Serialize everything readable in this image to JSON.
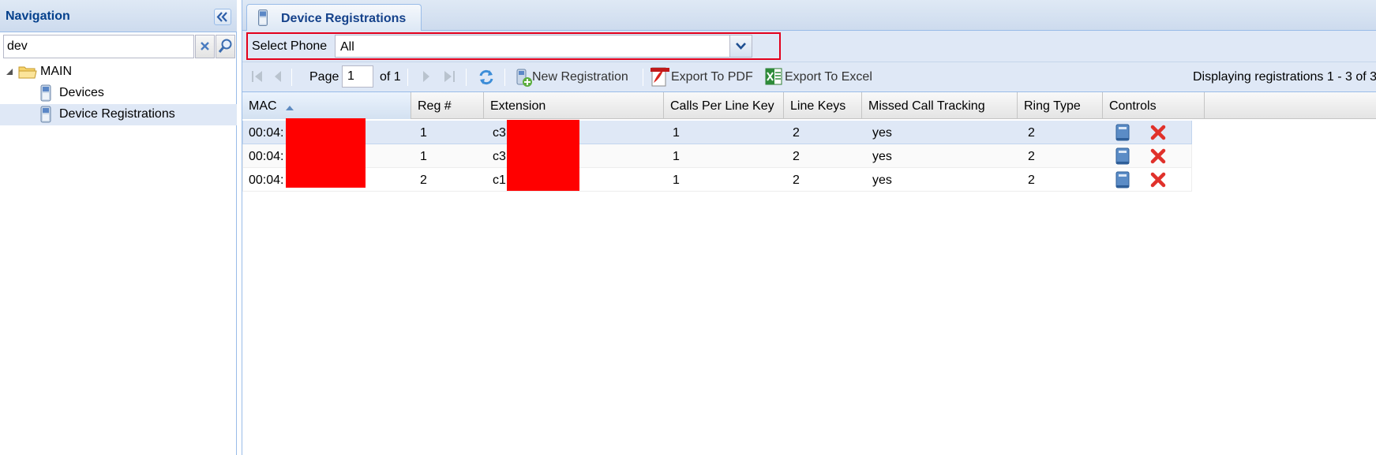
{
  "navigation": {
    "title": "Navigation",
    "search_value": "dev",
    "tree": [
      {
        "label": "MAIN",
        "icon": "folder-icon"
      },
      {
        "label": "Devices",
        "icon": "phone-icon"
      },
      {
        "label": "Device Registrations",
        "icon": "phone-icon",
        "selected": true
      }
    ]
  },
  "main": {
    "tab": {
      "label": "Device Registrations"
    },
    "filter": {
      "label": "Select Phone",
      "value": "All"
    },
    "toolbar": {
      "page_label": "Page",
      "page_value": "1",
      "of_label": "of 1",
      "new_label": "New Registration",
      "pdf_label": "Export To PDF",
      "excel_label": "Export To Excel",
      "status": "Displaying registrations 1 - 3 of 3"
    },
    "grid": {
      "columns": [
        "MAC",
        "Reg #",
        "Extension",
        "Calls Per Line Key",
        "Line Keys",
        "Missed Call Tracking",
        "Ring Type",
        "Controls"
      ],
      "sort": {
        "column": "MAC",
        "direction": "asc"
      },
      "rows": [
        {
          "mac": "00:04:",
          "reg": "1",
          "ext": "c3",
          "cplk": "1",
          "keys": "2",
          "missed": "yes",
          "ring": "2",
          "selected": true
        },
        {
          "mac": "00:04:",
          "reg": "1",
          "ext": "c3",
          "cplk": "1",
          "keys": "2",
          "missed": "yes",
          "ring": "2"
        },
        {
          "mac": "00:04:",
          "reg": "2",
          "ext": "c1",
          "cplk": "1",
          "keys": "2",
          "missed": "yes",
          "ring": "2"
        }
      ]
    }
  },
  "colors": {
    "accent": "#15428b",
    "panel_bg": "#dfe8f6",
    "highlight": "#e3001b",
    "redaction": "#ff0000"
  }
}
